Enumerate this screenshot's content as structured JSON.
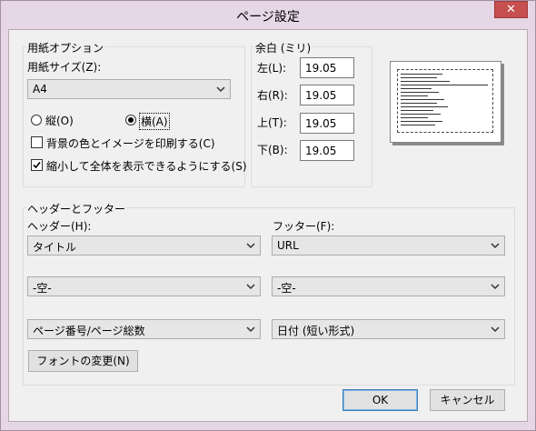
{
  "window": {
    "title": "ページ設定",
    "close_glyph": "✕"
  },
  "paper": {
    "group_label": "用紙オプション",
    "size_label": "用紙サイズ(Z):",
    "size_value": "A4",
    "orientation_portrait": "縦(O)",
    "orientation_landscape": "横(A)",
    "orientation_selected": "landscape",
    "print_background_label": "背景の色とイメージを印刷する(C)",
    "print_background_checked": false,
    "shrink_to_fit_label": "縮小して全体を表示できるようにする(S)",
    "shrink_to_fit_checked": true
  },
  "margins": {
    "group_label": "余白 (ミリ)",
    "left_label": "左(L):",
    "left_value": "19.05",
    "right_label": "右(R):",
    "right_value": "19.05",
    "top_label": "上(T):",
    "top_value": "19.05",
    "bottom_label": "下(B):",
    "bottom_value": "19.05"
  },
  "header_footer": {
    "group_label": "ヘッダーとフッター",
    "header_label": "ヘッダー(H):",
    "footer_label": "フッター(F):",
    "header_rows": [
      "タイトル",
      "-空-",
      "ページ番号/ページ総数"
    ],
    "footer_rows": [
      "URL",
      "-空-",
      "日付 (短い形式)"
    ],
    "font_button": "フォントの変更(N)"
  },
  "buttons": {
    "ok": "OK",
    "cancel": "キャンセル"
  },
  "colors": {
    "window_frame": "#e5d7e5",
    "close_button": "#c74f4f",
    "client_background": "#f0f0f0",
    "default_button_border": "#3c7fb1"
  }
}
